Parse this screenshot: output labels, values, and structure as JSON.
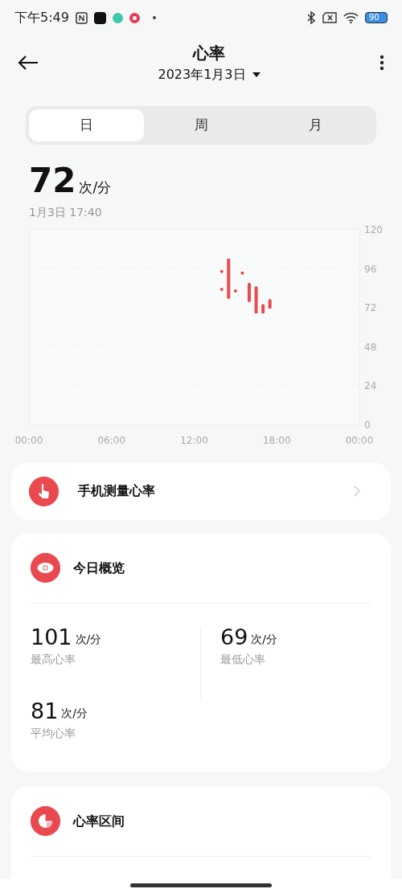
{
  "status_bar": {
    "time": "下午5:49",
    "battery": "90"
  },
  "header": {
    "title": "心率",
    "date": "2023年1月3日"
  },
  "tabs": [
    {
      "label": "日",
      "selected": true
    },
    {
      "label": "周",
      "selected": false
    },
    {
      "label": "月",
      "selected": false
    }
  ],
  "current": {
    "value": "72",
    "unit": "次/分",
    "time": "1月3日 17:40"
  },
  "chart": {
    "y_labels": [
      "120",
      "96",
      "72",
      "48",
      "24",
      "0"
    ],
    "x_labels": [
      "00:00",
      "06:00",
      "12:00",
      "18:00",
      "00:00"
    ]
  },
  "measure_card": {
    "label": "手机测量心率"
  },
  "overview": {
    "title": "今日概览",
    "stats": [
      {
        "value": "101",
        "unit": "次/分",
        "label": "最高心率"
      },
      {
        "value": "69",
        "unit": "次/分",
        "label": "最低心率"
      },
      {
        "value": "81",
        "unit": "次/分",
        "label": "平均心率"
      }
    ]
  },
  "zones": {
    "title": "心率区间"
  }
}
